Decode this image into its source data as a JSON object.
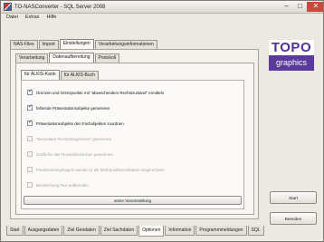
{
  "window": {
    "title": "TO-NASConverter - SQL Server 2008",
    "minimize": "–",
    "maximize": "□",
    "close": "✕"
  },
  "menu": [
    "Datei",
    "Extras",
    "Hilfe"
  ],
  "top_tabs": [
    "NAS-Files",
    "Import",
    "Einstellungen",
    "Verarbeitungsinformationen"
  ],
  "top_tabs_active": 2,
  "sub_tabs": [
    "Verarbeitung",
    "Datenaufbereitung",
    "Protokoll"
  ],
  "sub_tabs_active": 1,
  "inner_tabs": [
    "für ALKIS-Karte",
    "für ALKIS-Buch"
  ],
  "inner_tabs_active": 0,
  "options": [
    {
      "label": "Grenzen und Grenzpunkte mit \"abweichendem Rechtszustand\" ermitteln",
      "checked": true,
      "enabled": true
    },
    {
      "label": "fehlende Präsentationsobjekte generieren",
      "checked": true,
      "enabled": true
    },
    {
      "label": "Präsentationsobjekte den Fachobjekten zuordnen",
      "checked": true,
      "enabled": true
    },
    {
      "label": "\"besondere Flurstücksgrenzen\" generieren",
      "checked": false,
      "enabled": false
    },
    {
      "label": "Grafik für das Flurstückszeichen generieren",
      "checked": false,
      "enabled": false
    },
    {
      "label": "Positionierungsregeln werden in die Mehrpunktkoordinaten eingerechnet",
      "checked": false,
      "enabled": false
    },
    {
      "label": "Bezeichnung Text aufbereiten",
      "checked": false,
      "enabled": false
    }
  ],
  "reset_button": "setze Voreinstellung",
  "logo": {
    "top": "TOPO",
    "bottom": "graphics"
  },
  "start_button": "Start",
  "exit_button": "Beenden",
  "bottom_tabs": [
    "Start",
    "Ausgangsdaten",
    "Ziel Geodaten",
    "Ziel Sachdaten",
    "Optionen",
    "Information",
    "Programmmeldungen",
    "SQL"
  ],
  "bottom_tabs_active": 4
}
